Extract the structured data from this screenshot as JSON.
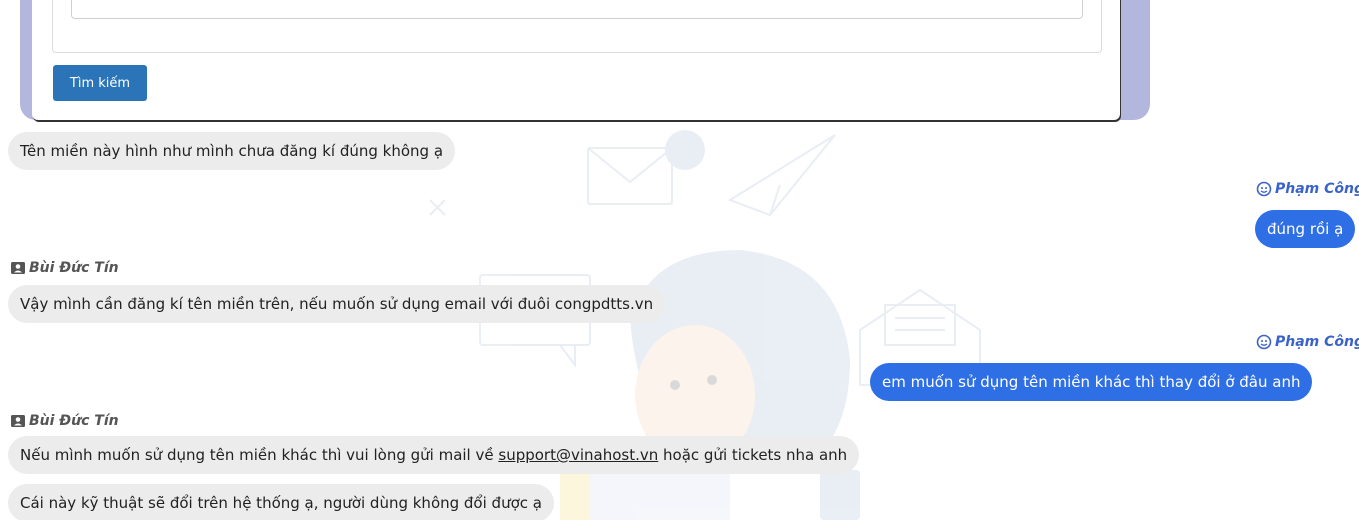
{
  "search": {
    "button_label": "Tìm kiếm"
  },
  "messages": [
    {
      "type": "in",
      "text": "Tên miền này hình như mình chưa đăng kí đúng không ạ"
    },
    {
      "type": "out",
      "sender": "Phạm Công",
      "text": "đúng rồi ạ"
    },
    {
      "type": "in",
      "sender": "Bùi Đức Tín",
      "text": "Vậy mình cần đăng kí tên miền trên, nếu muốn sử dụng email với đuôi congpdtts.vn"
    },
    {
      "type": "out",
      "sender": "Phạm Công",
      "text": "em muốn sử dụng tên miền khác thì thay đổi ở đâu anh"
    },
    {
      "type": "in",
      "sender": "Bùi Đức Tín",
      "text_before": "Nếu mình muốn sử dụng tên miền khác thì vui lòng gửi mail về ",
      "link": "support@vinahost.vn",
      "text_after": " hoặc gửi tickets nha anh"
    },
    {
      "type": "in",
      "text": "Cái này kỹ thuật sẽ đổi trên hệ thống ạ, người dùng không đổi được ạ"
    }
  ],
  "colors": {
    "outgoing_bubble": "#2f6fe6",
    "incoming_bubble": "#ececec",
    "search_button": "#2b74b8",
    "frame": "#b3b6dd",
    "outgoing_sender": "#3a63c9"
  },
  "icons": {
    "incoming_sender": "user-card-icon",
    "outgoing_sender": "smiley-face-icon"
  }
}
